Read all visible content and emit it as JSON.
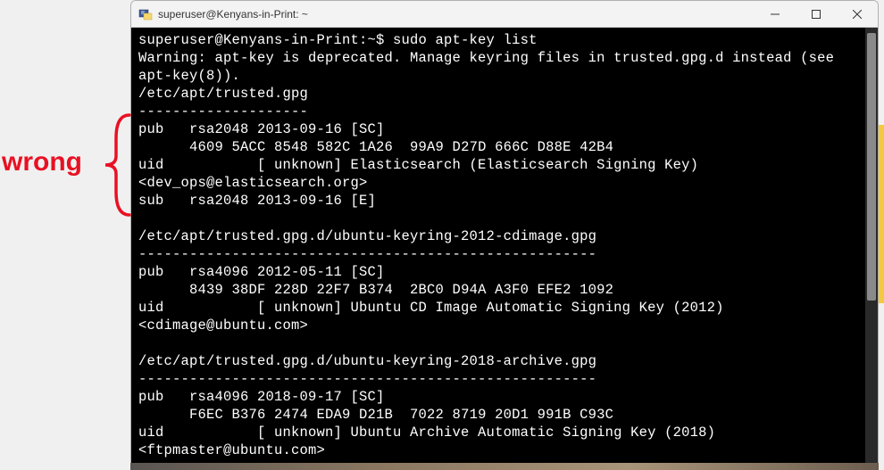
{
  "annotation": {
    "text": "wrong"
  },
  "window": {
    "title": "superuser@Kenyans-in-Print: ~"
  },
  "terminal": {
    "lines": [
      "superuser@Kenyans-in-Print:~$ sudo apt-key list",
      "Warning: apt-key is deprecated. Manage keyring files in trusted.gpg.d instead (see apt-key(8)).",
      "/etc/apt/trusted.gpg",
      "--------------------",
      "pub   rsa2048 2013-09-16 [SC]",
      "      4609 5ACC 8548 582C 1A26  99A9 D27D 666C D88E 42B4",
      "uid           [ unknown] Elasticsearch (Elasticsearch Signing Key) <dev_ops@elasticsearch.org>",
      "sub   rsa2048 2013-09-16 [E]",
      "",
      "/etc/apt/trusted.gpg.d/ubuntu-keyring-2012-cdimage.gpg",
      "------------------------------------------------------",
      "pub   rsa4096 2012-05-11 [SC]",
      "      8439 38DF 228D 22F7 B374  2BC0 D94A A3F0 EFE2 1092",
      "uid           [ unknown] Ubuntu CD Image Automatic Signing Key (2012) <cdimage@ubuntu.com>",
      "",
      "/etc/apt/trusted.gpg.d/ubuntu-keyring-2018-archive.gpg",
      "------------------------------------------------------",
      "pub   rsa4096 2018-09-17 [SC]",
      "      F6EC B376 2474 EDA9 D21B  7022 8719 20D1 991B C93C",
      "uid           [ unknown] Ubuntu Archive Automatic Signing Key (2018) <ftpmaster@ubuntu.com>"
    ]
  }
}
